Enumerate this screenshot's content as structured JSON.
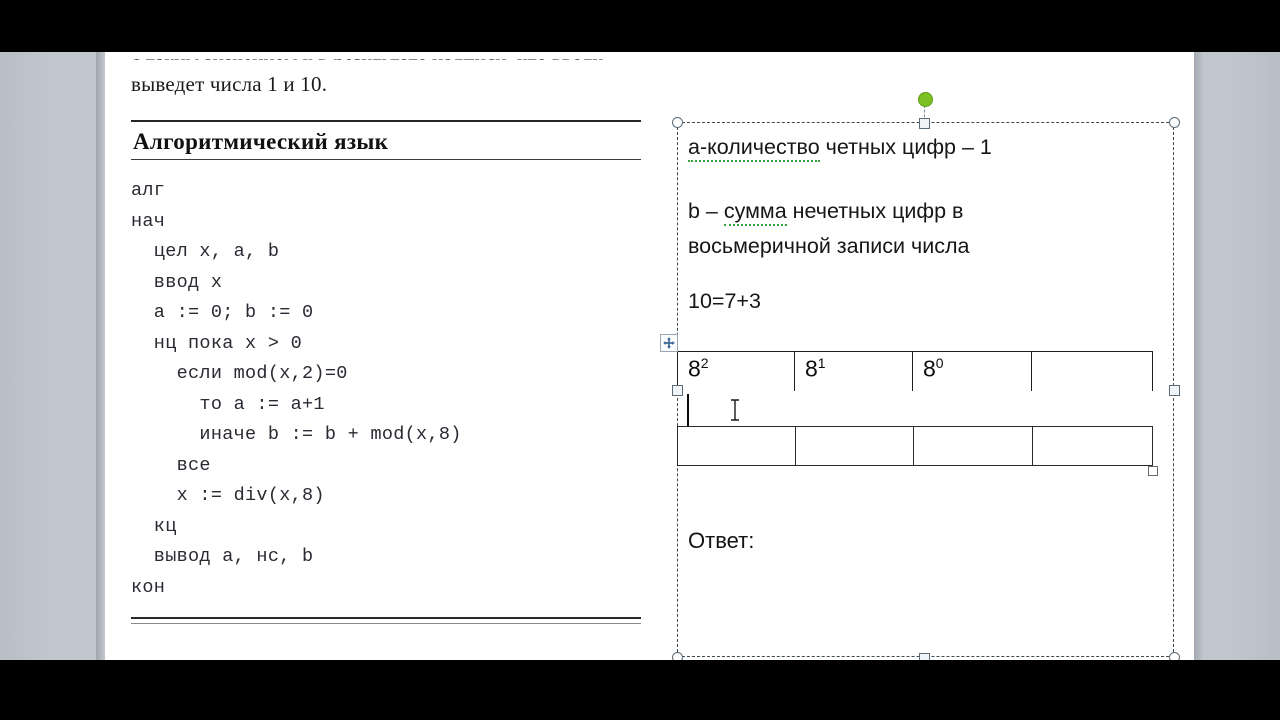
{
  "document": {
    "cut_top_line": "с таким значением x в результате надписи, что вводу второго аргумента",
    "lead_line": "выведет числа 1 и 10.",
    "section_heading": "Алгоритмический язык",
    "code": "алг\nнач\n  цел x, a, b\n  ввод x\n  a := 0; b := 0\n  нц пока x > 0\n    если mod(x,2)=0\n      то a := a+1\n      иначе b := b + mod(x,8)\n    все\n    x := div(x,8)\n  кц\n  вывод a, нс, b\nкон"
  },
  "textbox": {
    "lines": [
      {
        "prefix": "",
        "spell": "а-количество",
        "suffix": " четных цифр – 1"
      },
      {
        "prefix": "b – ",
        "spell": "сумма",
        "suffix": " нечетных цифр в"
      },
      {
        "prefix": "восьмеричной записи числа",
        "spell": "",
        "suffix": ""
      },
      {
        "prefix": "10=7+3",
        "spell": "",
        "suffix": ""
      }
    ],
    "answer_label": "Ответ:",
    "selection": {
      "handle_icon": "resize-handle",
      "rotate_icon": "rotate-handle",
      "border_style": "dashed"
    }
  },
  "table": {
    "row1": [
      {
        "base": "8",
        "exp": "2"
      },
      {
        "base": "8",
        "exp": "1"
      },
      {
        "base": "8",
        "exp": "0"
      },
      {
        "base": "",
        "exp": ""
      }
    ],
    "row2": [
      "",
      "",
      "",
      ""
    ],
    "move_handle_icon": "move-four-arrows-icon",
    "resize_handle_icon": "table-resize-handle-icon"
  },
  "cursor": {
    "caret_icon": "text-caret",
    "pointer_icon": "ibeam-pointer-icon"
  },
  "colors": {
    "spellcheck_underline": "#3aa13a",
    "rotate_handle": "#7cc024",
    "handle_outline": "#5b6b78",
    "page_background": "#ffffff",
    "workspace_background": "#c6cad2",
    "letterbox": "#000000"
  }
}
